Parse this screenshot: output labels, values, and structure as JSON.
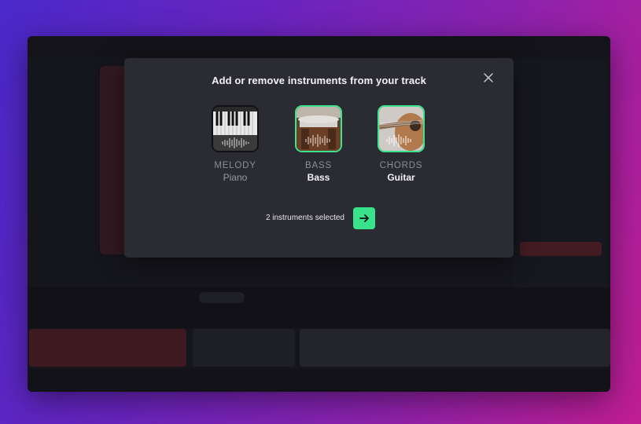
{
  "modal": {
    "title": "Add or remove instruments from your track",
    "close_icon": "close-icon",
    "instruments": [
      {
        "category": "MELODY",
        "instrument": "Piano",
        "selected": false,
        "icon": "piano-keys-image"
      },
      {
        "category": "BASS",
        "instrument": "Bass",
        "selected": true,
        "icon": "bass-instrument-image"
      },
      {
        "category": "CHORDS",
        "instrument": "Guitar",
        "selected": true,
        "icon": "acoustic-guitar-image"
      }
    ],
    "selection_count_text": "2 instruments selected",
    "next_icon": "arrow-right-icon"
  },
  "colors": {
    "accent": "#39e38b",
    "selected_border": "#3ee38c",
    "modal_bg": "#2b2b33",
    "window_bg": "#1d1d24"
  }
}
